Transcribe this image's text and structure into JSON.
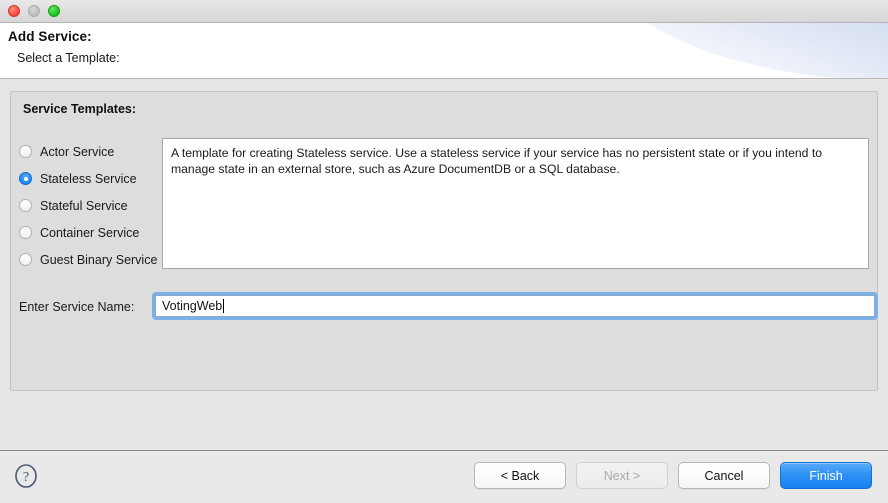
{
  "window": {
    "controls": {
      "close": "close-button",
      "minimize": "minimize-button",
      "zoom": "zoom-button"
    }
  },
  "header": {
    "title": "Add Service:",
    "subtitle": "Select a Template:"
  },
  "panel": {
    "title": "Service Templates:",
    "templates": [
      {
        "label": "Actor Service",
        "selected": false
      },
      {
        "label": "Stateless Service",
        "selected": true
      },
      {
        "label": "Stateful Service",
        "selected": false
      },
      {
        "label": "Container Service",
        "selected": false
      },
      {
        "label": "Guest Binary Service",
        "selected": false
      }
    ],
    "description": "A template for creating Stateless service.  Use a stateless service if your service has no persistent state or if you intend to manage state in an external store, such as Azure DocumentDB or a SQL database.",
    "name_label": "Enter Service Name:",
    "name_value": "VotingWeb",
    "name_placeholder": ""
  },
  "footer": {
    "help_icon": "help-icon",
    "buttons": [
      {
        "label": "< Back",
        "state": "enabled",
        "style": "default"
      },
      {
        "label": "Next >",
        "state": "disabled",
        "style": "default"
      },
      {
        "label": "Cancel",
        "state": "enabled",
        "style": "default"
      },
      {
        "label": "Finish",
        "state": "enabled",
        "style": "primary"
      }
    ]
  },
  "colors": {
    "accent": "#1681f0",
    "panel_bg": "#dddddd",
    "body_bg": "#e6e6e6",
    "focus_ring": "#7cb0e8"
  }
}
